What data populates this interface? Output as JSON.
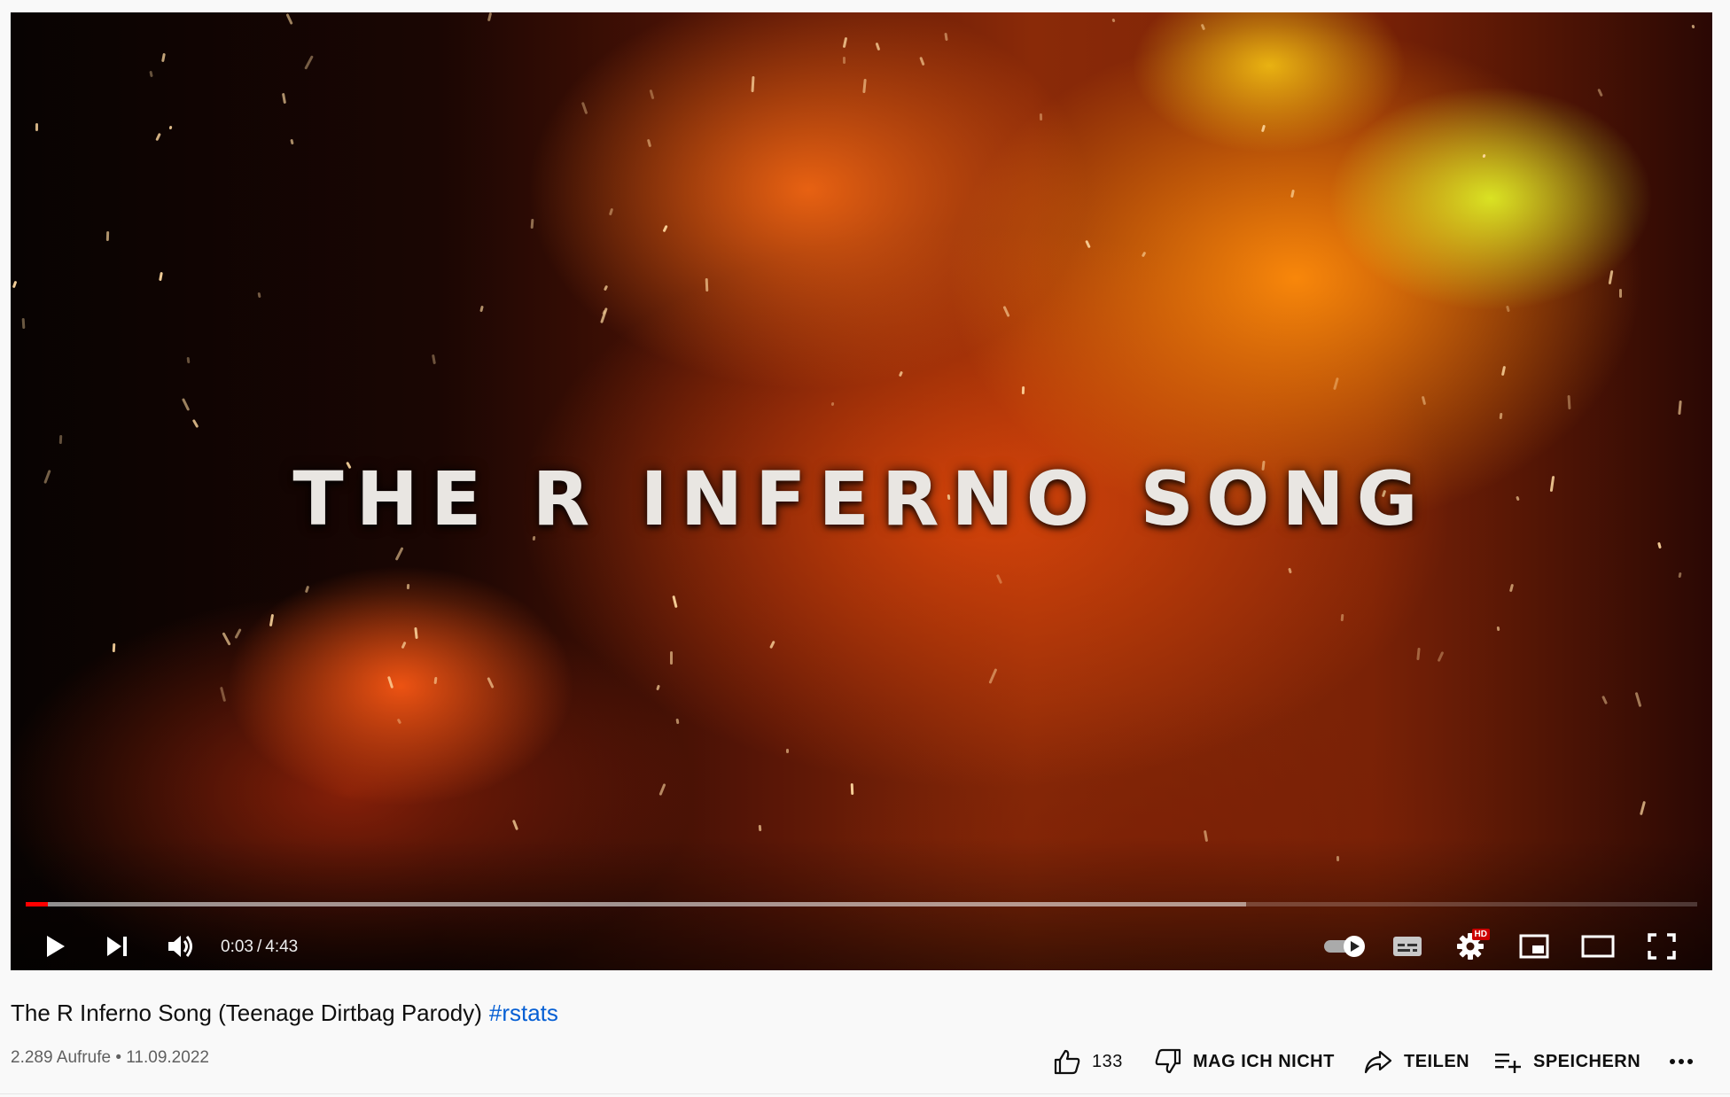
{
  "player": {
    "video_overlay_text": "THE R INFERNO SONG",
    "progress": {
      "played_fraction": 0.013,
      "loaded_fraction": 0.73
    },
    "time": {
      "current": "0:03",
      "separator": "/",
      "duration": "4:43"
    },
    "badges": {
      "hd": "HD"
    },
    "icons": {
      "play": "play-icon",
      "next": "next-icon",
      "volume": "volume-icon",
      "autoplay": "autoplay-toggle-icon",
      "subtitles": "subtitles-icon",
      "settings": "gear-icon",
      "miniplayer": "miniplayer-icon",
      "theater": "theater-mode-icon",
      "fullscreen": "fullscreen-icon"
    },
    "accent_color": "#ff0000"
  },
  "video": {
    "title": "The R Inferno Song (Teenage Dirtbag Parody)",
    "hashtag": "#rstats",
    "views": "2.289 Aufrufe",
    "bullet": "•",
    "date": "11.09.2022"
  },
  "actions": {
    "like_count": "133",
    "dislike_label": "MAG ICH NICHT",
    "share_label": "TEILEN",
    "save_label": "SPEICHERN",
    "more_icon": "more-horizontal-icon"
  },
  "colors": {
    "link": "#065fd4",
    "secondary_text": "#606060"
  }
}
